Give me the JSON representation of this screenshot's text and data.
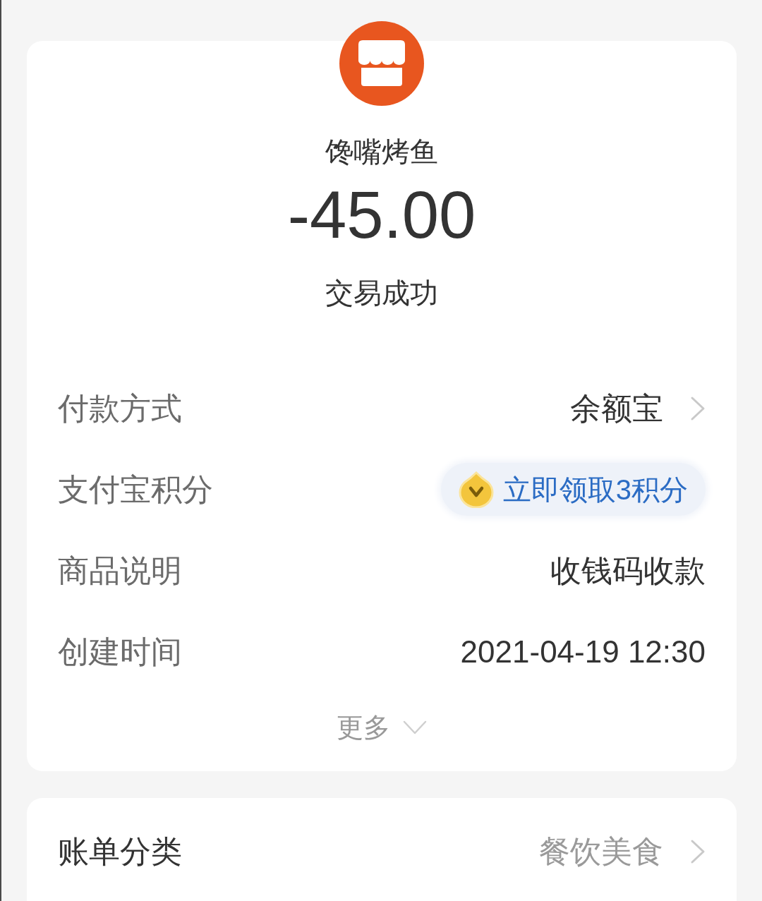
{
  "merchant": {
    "name": "馋嘴烤鱼",
    "amount": "-45.00",
    "status": "交易成功"
  },
  "details": [
    {
      "kind": "link",
      "label": "付款方式",
      "value": "余额宝"
    },
    {
      "kind": "badge",
      "label": "支付宝积分",
      "value": "立即领取3积分"
    },
    {
      "kind": "text",
      "label": "商品说明",
      "value": "收钱码收款"
    },
    {
      "kind": "text",
      "label": "创建时间",
      "value": "2021-04-19 12:30"
    }
  ],
  "more": {
    "label": "更多",
    "expanded": false
  },
  "category": {
    "label": "账单分类",
    "value": "餐饮美食"
  }
}
